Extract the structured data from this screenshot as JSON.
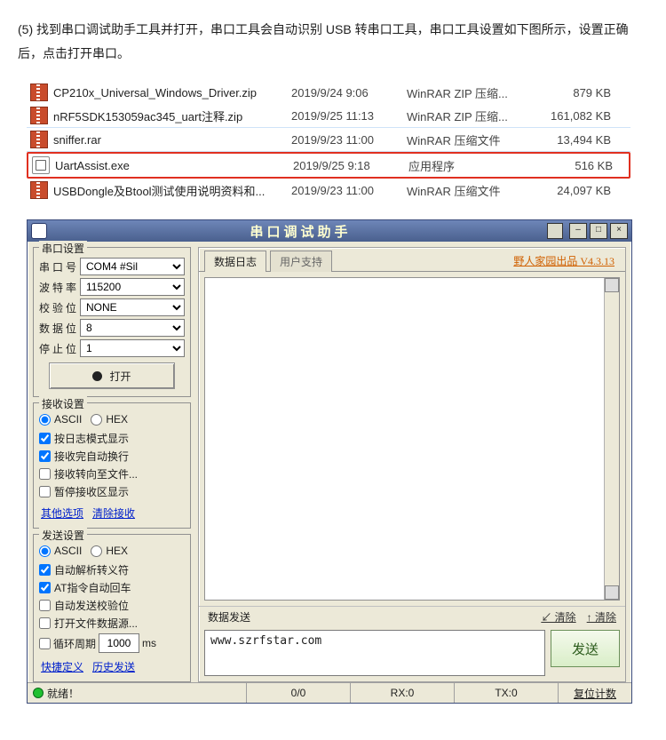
{
  "instruction": "(5) 找到串口调试助手工具并打开，串口工具会自动识别 USB 转串口工具，串口工具设置如下图所示，设置正确后，点击打开串口。",
  "files": [
    {
      "name": "CP210x_Universal_Windows_Driver.zip",
      "date": "2019/9/24 9:06",
      "type": "WinRAR ZIP 压缩...",
      "size": "879 KB",
      "icon": "zip"
    },
    {
      "name": "nRF5SDK153059ac345_uart注释.zip",
      "date": "2019/9/25 11:13",
      "type": "WinRAR ZIP 压缩...",
      "size": "161,082 KB",
      "icon": "zip"
    },
    {
      "name": "sniffer.rar",
      "date": "2019/9/23 11:00",
      "type": "WinRAR 压缩文件",
      "size": "13,494 KB",
      "icon": "zip"
    },
    {
      "name": "UartAssist.exe",
      "date": "2019/9/25 9:18",
      "type": "应用程序",
      "size": "516 KB",
      "icon": "exe"
    },
    {
      "name": "USBDongle及Btool测试使用说明资料和...",
      "date": "2019/9/23 11:00",
      "type": "WinRAR 压缩文件",
      "size": "24,097 KB",
      "icon": "zip"
    }
  ],
  "app": {
    "title": "串口调试助手",
    "brand": "野人家园出品  V4.3.13",
    "groups": {
      "port": "串口设置",
      "recv": "接收设置",
      "send": "发送设置"
    },
    "port": {
      "labels": {
        "com": "串口号",
        "baud": "波特率",
        "parity": "校验位",
        "data": "数据位",
        "stop": "停止位"
      },
      "values": {
        "com": "COM4 #Sil",
        "baud": "115200",
        "parity": "NONE",
        "data": "8",
        "stop": "1"
      },
      "open_btn": "打开"
    },
    "recv": {
      "radios": {
        "ascii": "ASCII",
        "hex": "HEX"
      },
      "chk1": "按日志模式显示",
      "chk2": "接收完自动换行",
      "chk3": "接收转向至文件...",
      "chk4": "暂停接收区显示",
      "links": {
        "more": "其他选项",
        "clear": "清除接收"
      }
    },
    "send": {
      "radios": {
        "ascii": "ASCII",
        "hex": "HEX"
      },
      "chk1": "自动解析转义符",
      "chk2": "AT指令自动回车",
      "chk3": "自动发送校验位",
      "chk4": "打开文件数据源...",
      "loop_label": "循环周期",
      "loop_val": "1000",
      "loop_unit": "ms",
      "links": {
        "quick": "快捷定义",
        "history": "历史发送"
      }
    },
    "tabs": {
      "log": "数据日志",
      "support": "用户支持"
    },
    "sendarea": {
      "label": "数据发送",
      "clear_dn": "↙ 清除",
      "clear_up": "↑ 清除",
      "value": "www.szrfstar.com",
      "btn": "发送"
    },
    "status": {
      "ready": "就绪！",
      "prog": "0/0",
      "rx": "RX:0",
      "tx": "TX:0",
      "reset": "复位计数"
    }
  }
}
